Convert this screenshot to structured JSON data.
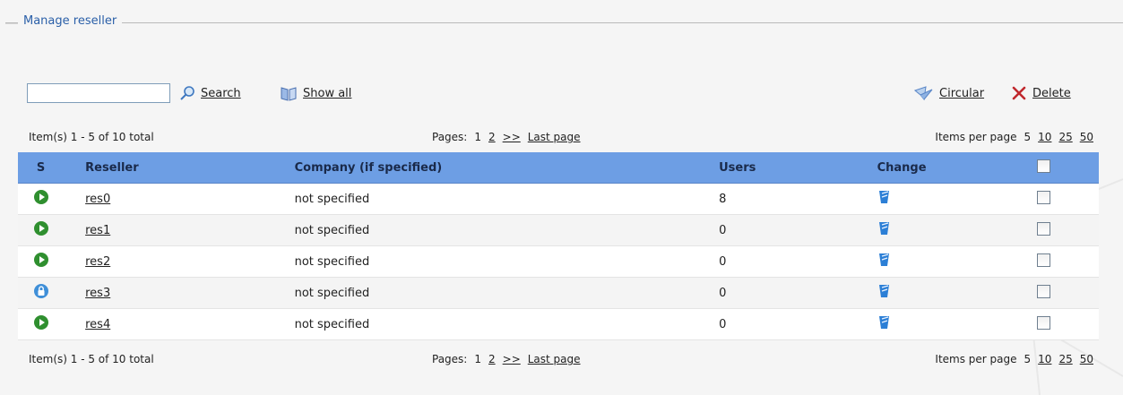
{
  "legend": "Manage reseller",
  "toolbar": {
    "search_value": "",
    "search_label": "Search",
    "show_all_label": "Show all",
    "circular_label": "Circular",
    "delete_label": "Delete"
  },
  "pager_top": {
    "items_text": "Item(s) 1 - 5 of 10 total",
    "pages_label": "Pages:",
    "page_current": "1",
    "page_2": "2",
    "next": ">>",
    "last": "Last page",
    "per_page_label": "Items per page",
    "per_page_current": "5",
    "per_page_10": "10",
    "per_page_25": "25",
    "per_page_50": "50"
  },
  "pager_bottom": {
    "items_text": "Item(s) 1 - 5 of 10 total",
    "pages_label": "Pages:",
    "page_current": "1",
    "page_2": "2",
    "next": ">>",
    "last": "Last page",
    "per_page_label": "Items per page",
    "per_page_current": "5",
    "per_page_10": "10",
    "per_page_25": "25",
    "per_page_50": "50"
  },
  "table": {
    "headers": {
      "s": "S",
      "reseller": "Reseller",
      "company": "Company (if specified)",
      "users": "Users",
      "change": "Change"
    },
    "rows": [
      {
        "status": "active",
        "reseller": "res0",
        "company": "not specified",
        "users": "8"
      },
      {
        "status": "active",
        "reseller": "res1",
        "company": "not specified",
        "users": "0"
      },
      {
        "status": "active",
        "reseller": "res2",
        "company": "not specified",
        "users": "0"
      },
      {
        "status": "locked",
        "reseller": "res3",
        "company": "not specified",
        "users": "0"
      },
      {
        "status": "active",
        "reseller": "res4",
        "company": "not specified",
        "users": "0"
      }
    ]
  },
  "colors": {
    "header_bg": "#6d9ee4",
    "legend": "#2a5fa8",
    "active": "#2f8f2f",
    "locked": "#3f8fd8",
    "delete": "#c0282d"
  }
}
